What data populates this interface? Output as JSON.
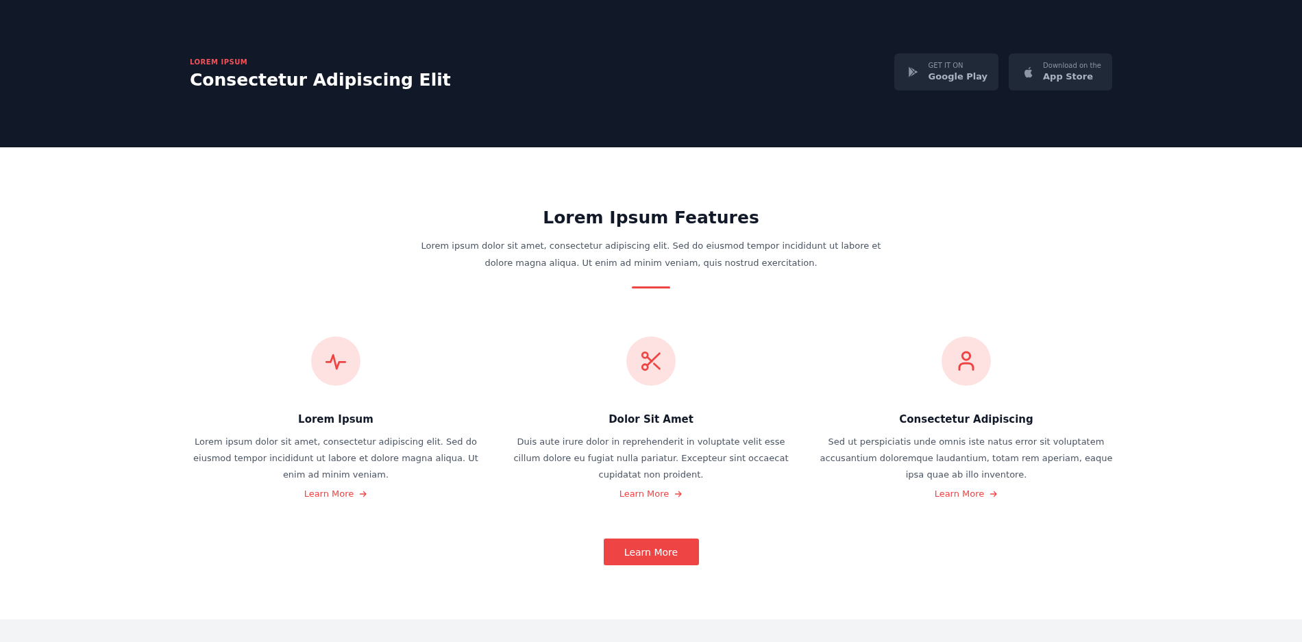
{
  "header": {
    "eyebrow": "LOREM IPSUM",
    "title": "Consectetur Adipiscing Elit",
    "store_buttons": [
      {
        "kind": "google",
        "small": "GET IT ON",
        "big": "Google Play"
      },
      {
        "kind": "apple",
        "small": "Download on the",
        "big": "App Store"
      }
    ]
  },
  "features": {
    "title": "Lorem Ipsum Features",
    "intro": "Lorem ipsum dolor sit amet, consectetur adipiscing elit. Sed do eiusmod tempor incididunt ut labore et dolore magna aliqua. Ut enim ad minim veniam, quis nostrud exercitation.",
    "items": [
      {
        "kind": "pulse",
        "title": "Lorem Ipsum",
        "text": "Lorem ipsum dolor sit amet, consectetur adipiscing elit. Sed do eiusmod tempor incididunt ut labore et dolore magna aliqua. Ut enim ad minim veniam.",
        "link": "Learn More"
      },
      {
        "kind": "scissors",
        "title": "Dolor Sit Amet",
        "text": "Duis aute irure dolor in reprehenderit in voluptate velit esse cillum dolore eu fugiat nulla pariatur. Excepteur sint occaecat cupidatat non proident.",
        "link": "Learn More"
      },
      {
        "kind": "user",
        "title": "Consectetur Adipiscing",
        "text": "Sed ut perspiciatis unde omnis iste natus error sit voluptatem accusantium doloremque laudantium, totam rem aperiam, eaque ipsa quae ab illo inventore.",
        "link": "Learn More"
      }
    ],
    "button": "Learn More"
  }
}
